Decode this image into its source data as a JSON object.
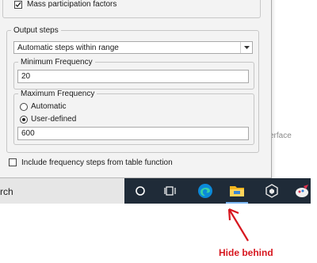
{
  "dialog": {
    "mass_participation_label": "Mass participation factors",
    "output_steps": {
      "legend": "Output steps",
      "select_value": "Automatic steps within range",
      "min_frequency": {
        "legend": "Minimum Frequency",
        "value": "20"
      },
      "max_frequency": {
        "legend": "Maximum Frequency",
        "option_automatic": "Automatic",
        "option_user_defined": "User-defined",
        "selected": "User-defined",
        "value": "600"
      }
    },
    "include_label": "Include frequency steps from table function"
  },
  "background": {
    "partial_text": "erface"
  },
  "taskbar": {
    "search_text": "rch",
    "icons": [
      "cortana-circle-icon",
      "task-view-icon",
      "edge-icon",
      "file-explorer-icon",
      "3d-cube-app-icon",
      "paint-app-icon"
    ],
    "accent": "#1f2b38"
  },
  "annotation": {
    "text": "Hide behind",
    "color": "#d7171f"
  }
}
